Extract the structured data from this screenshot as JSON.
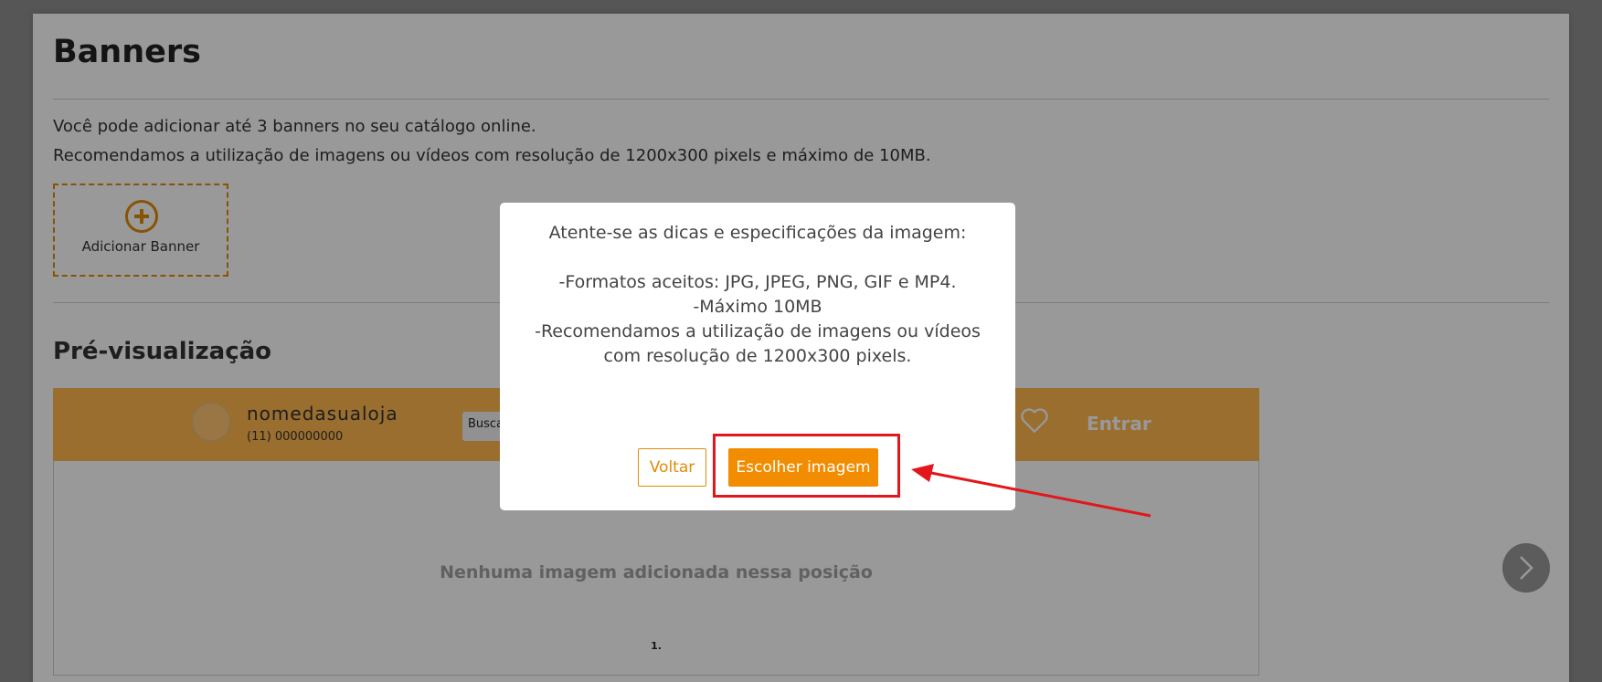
{
  "page": {
    "title": "Banners",
    "info_line_1": "Você pode adicionar até 3 banners no seu catálogo online.",
    "info_line_2": "Recomendamos a utilização de imagens ou vídeos com resolução de 1200x300 pixels e máximo de 10MB.",
    "add_banner_label": "Adicionar Banner",
    "add_banner_icon": "plus-circle-icon",
    "preview_title": "Pré-visualização"
  },
  "preview": {
    "store_name": "nomedasualoja",
    "store_phone": "(11) 000000000",
    "search_placeholder": "Busca",
    "login_label": "Entrar",
    "empty_message": "Nenhuma imagem adicionada nessa posição",
    "position_number": "1.",
    "header_color": "#ffb84d"
  },
  "modal": {
    "heading": "Atente-se as dicas e especificações da imagem:",
    "spec_formats": "-Formatos aceitos: JPG, JPEG, PNG, GIF e MP4.",
    "spec_max_size": "-Máximo 10MB",
    "spec_recommendation": "-Recomendamos a utilização de imagens ou vídeos com resolução de 1200x300 pixels.",
    "back_label": "Voltar",
    "choose_label": "Escolher imagem"
  },
  "colors": {
    "accent": "#f28c00",
    "annotation": "#e2161b"
  }
}
